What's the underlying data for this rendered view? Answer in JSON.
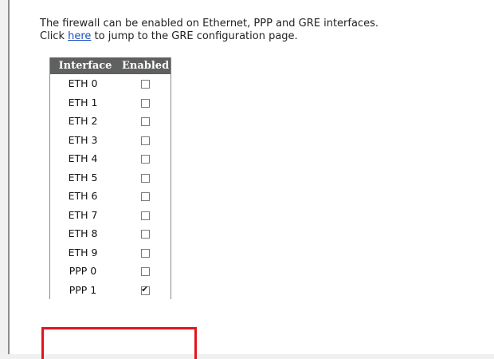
{
  "intro": {
    "line1": "The firewall can be enabled on Ethernet, PPP and GRE interfaces.",
    "line2_prefix": "Click ",
    "link_text": "here",
    "line2_suffix": " to jump to the GRE configuration page."
  },
  "table": {
    "headers": [
      "Interface",
      "Enabled"
    ],
    "rows": [
      {
        "name": "ETH 0",
        "enabled": false
      },
      {
        "name": "ETH 1",
        "enabled": false
      },
      {
        "name": "ETH 2",
        "enabled": false
      },
      {
        "name": "ETH 3",
        "enabled": false
      },
      {
        "name": "ETH 4",
        "enabled": false
      },
      {
        "name": "ETH 5",
        "enabled": false
      },
      {
        "name": "ETH 6",
        "enabled": false
      },
      {
        "name": "ETH 7",
        "enabled": false
      },
      {
        "name": "ETH 8",
        "enabled": false
      },
      {
        "name": "ETH 9",
        "enabled": false
      },
      {
        "name": "PPP 0",
        "enabled": false
      },
      {
        "name": "PPP 1",
        "enabled": true
      }
    ]
  },
  "colors": {
    "header_bg": "#5f6060",
    "link": "#1a4fc0",
    "highlight": "#e3141a"
  },
  "icons": {
    "checkmark": "check-icon"
  }
}
